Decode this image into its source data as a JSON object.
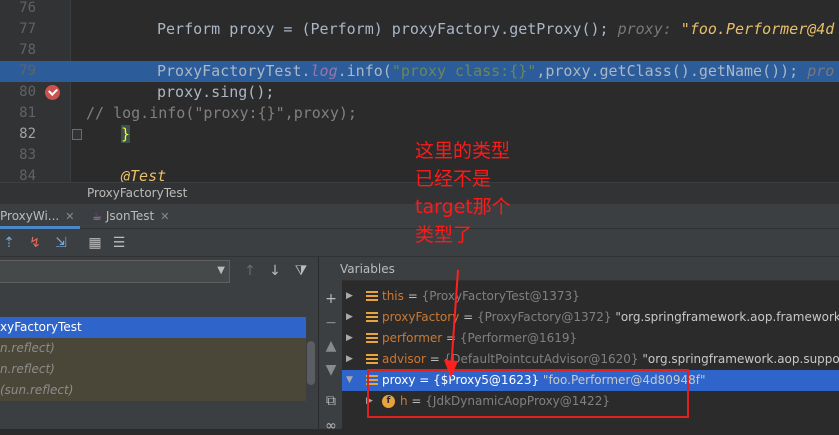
{
  "editor": {
    "lines": [
      {
        "num": "76"
      },
      {
        "num": "77",
        "segments": [
          {
            "c": "",
            "t": "Perform proxy = (Perform) proxyFactory.getProxy();  "
          },
          {
            "c": "t-hint",
            "t": "proxy: "
          },
          {
            "c": "t-hintv",
            "t": "\"foo.Performer@4d"
          }
        ]
      },
      {
        "num": "78"
      },
      {
        "num": "79",
        "highlight": true,
        "segments": [
          {
            "c": "",
            "t": "ProxyFactoryTest."
          },
          {
            "c": "t-it",
            "t": "log"
          },
          {
            "c": "",
            "t": ".info("
          },
          {
            "c": "t-str",
            "t": "\"proxy class:{}\""
          },
          {
            "c": "",
            "t": ",proxy.getClass().getName());  "
          },
          {
            "c": "t-hint",
            "t": "pro"
          }
        ]
      },
      {
        "num": "80",
        "breakpoint": true,
        "segments": [
          {
            "c": "",
            "t": "proxy.sing();"
          }
        ]
      },
      {
        "num": "81",
        "comment": true,
        "segments": [
          {
            "c": "t-cm",
            "t": "//      log.info(\"proxy:{}\",proxy);"
          }
        ]
      },
      {
        "num": "82",
        "current": true,
        "segments": [
          {
            "c": "t-brace",
            "t": "}"
          }
        ]
      },
      {
        "num": "83"
      },
      {
        "num": "84",
        "segments": [
          {
            "c": "t-hintv",
            "t": "@Test"
          }
        ]
      }
    ]
  },
  "breadcrumb": "ProxyFactoryTest",
  "tabs": [
    {
      "label": "ProxyWi...",
      "active": true
    },
    {
      "label": "JsonTest",
      "active": false
    }
  ],
  "frames": [
    {
      "label": "xyFactoryTest",
      "selected": true
    },
    {
      "label": "n.reflect)",
      "lib": true
    },
    {
      "label": "n.reflect)",
      "lib": true
    },
    {
      "label": "(sun.reflect)",
      "lib": true
    }
  ],
  "variables": {
    "title": "Variables",
    "items": [
      {
        "name": "this",
        "value": "{ProxyFactoryTest@1373}",
        "extra": ""
      },
      {
        "name": "proxyFactory",
        "value": "{ProxyFactory@1372}",
        "extra": "\"org.springframework.aop.framework.Pro"
      },
      {
        "name": "performer",
        "value": "{Performer@1619}",
        "extra": ""
      },
      {
        "name": "advisor",
        "value": "{DefaultPointcutAdvisor@1620}",
        "extra": "\"org.springframework.aop.support.D"
      },
      {
        "name": "proxy",
        "value": "{$Proxy5@1623}",
        "extra": "\"foo.Performer@4d80948f\"",
        "selected": true,
        "expanded": true
      },
      {
        "name": "h",
        "value": "{JdkDynamicAopProxy@1422}",
        "extra": "",
        "field": true
      }
    ]
  },
  "annotation": {
    "line1": "这里的类型",
    "line2": "已经不是",
    "line3": "target那个",
    "line4": "类型了",
    "color": "#ff1a1a"
  },
  "colors": {
    "selection": "#2f65ca",
    "highlight_line": "#2d5c9a",
    "breakpoint": "#c75450"
  }
}
